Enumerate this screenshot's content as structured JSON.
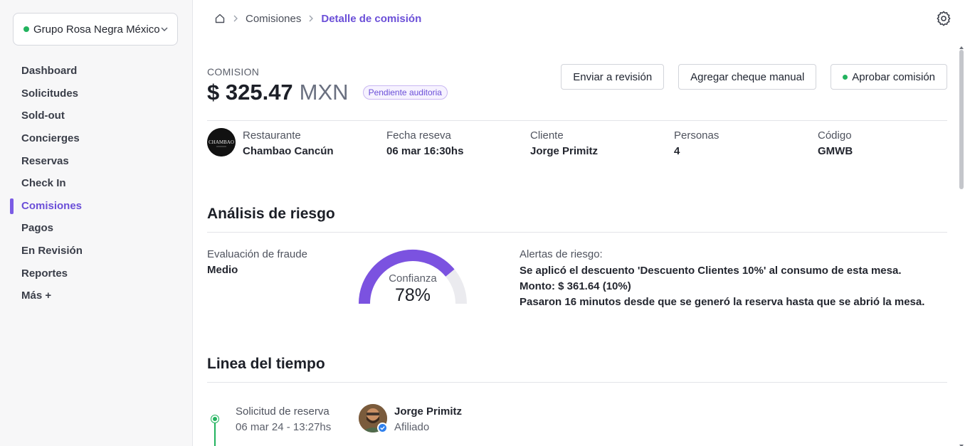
{
  "sidebar": {
    "org": {
      "name": "Grupo Rosa Negra México",
      "status_color": "#22b35e"
    },
    "items": [
      {
        "label": "Dashboard"
      },
      {
        "label": "Solicitudes"
      },
      {
        "label": "Sold-out"
      },
      {
        "label": "Concierges"
      },
      {
        "label": "Reservas"
      },
      {
        "label": "Check In"
      },
      {
        "label": "Comisiones",
        "active": true
      },
      {
        "label": "Pagos"
      },
      {
        "label": "En Revisión"
      },
      {
        "label": "Reportes"
      },
      {
        "label": "Más +"
      }
    ]
  },
  "breadcrumb": {
    "home_icon": "home-icon",
    "items": [
      "Comisiones",
      "Detalle de comisión"
    ]
  },
  "header": {
    "label": "COMISION",
    "amount": "$ 325.47",
    "currency": "MXN",
    "status_badge": "Pendiente auditoria"
  },
  "actions": {
    "send_review": "Enviar a revisión",
    "add_check": "Agregar cheque manual",
    "approve": "Aprobar comisión"
  },
  "details": {
    "restaurant": {
      "label": "Restaurante",
      "value": "Chambao Cancún",
      "logo_text": "CHAMBAO"
    },
    "date": {
      "label": "Fecha reseva",
      "value": "06 mar 16:30hs"
    },
    "client": {
      "label": "Cliente",
      "value": "Jorge Primitz"
    },
    "people": {
      "label": "Personas",
      "value": "4"
    },
    "code": {
      "label": "Código",
      "value": "GMWB"
    }
  },
  "risk": {
    "title": "Análisis de riesgo",
    "fraud_label": "Evaluación de fraude",
    "fraud_value": "Medio",
    "confidence_label": "Confianza",
    "confidence_value": "78%",
    "confidence_fraction": 0.78,
    "gauge_color": "#7b52e0",
    "gauge_track_color": "#ebebef",
    "alerts_title": "Alertas de riesgo:",
    "alerts": [
      "Se aplicó el descuento 'Descuento Clientes 10%' al consumo de esta mesa. Monto: $ 361.64 (10%)",
      "Pasaron 16 minutos desde que se generó la reserva hasta que se abrió la mesa."
    ]
  },
  "timeline": {
    "title": "Linea del tiempo",
    "events": [
      {
        "title": "Solicitud de reserva",
        "date": "06 mar 24 - 13:27hs",
        "user": "Jorge Primitz",
        "role": "Afiliado"
      }
    ]
  }
}
